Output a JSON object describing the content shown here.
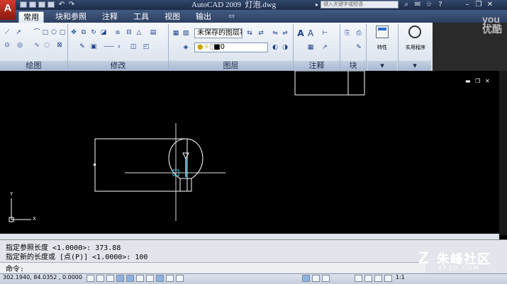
{
  "app": {
    "logo": "A",
    "title": "AutoCAD 2009",
    "filename": "灯泡.dwg",
    "search_placeholder": "键入关键字或短语"
  },
  "tabs": [
    "常用",
    "块和参照",
    "注释",
    "工具",
    "视图",
    "输出"
  ],
  "active_tab": "常用",
  "ribbon": {
    "panels": {
      "draw": "绘图",
      "modify": "修改",
      "layers": "图层",
      "annotation": "注释",
      "block": "块"
    },
    "layer_state": "未保存的图层状态",
    "current_layer": "0",
    "properties_label": "特性",
    "utilities_label": "实用程序"
  },
  "watermark_top": "you\n优酷",
  "command": {
    "line1": "指定参照长度 <1.0000>: 373.88",
    "line2": "指定新的长度或 [点(P)] <1.0000>:  100",
    "prompt": "命令:"
  },
  "status": {
    "coordinates": "302.1940, 84.0352 , 0.0000",
    "scale": "1:1"
  },
  "ucs": {
    "x": "X",
    "y": "Y"
  },
  "site": {
    "name": "朱峰社区",
    "url": "ZF3D.COM"
  },
  "colors": {
    "brand_red": "#c72c1f",
    "ribbon_blue": "#2b3e60"
  }
}
